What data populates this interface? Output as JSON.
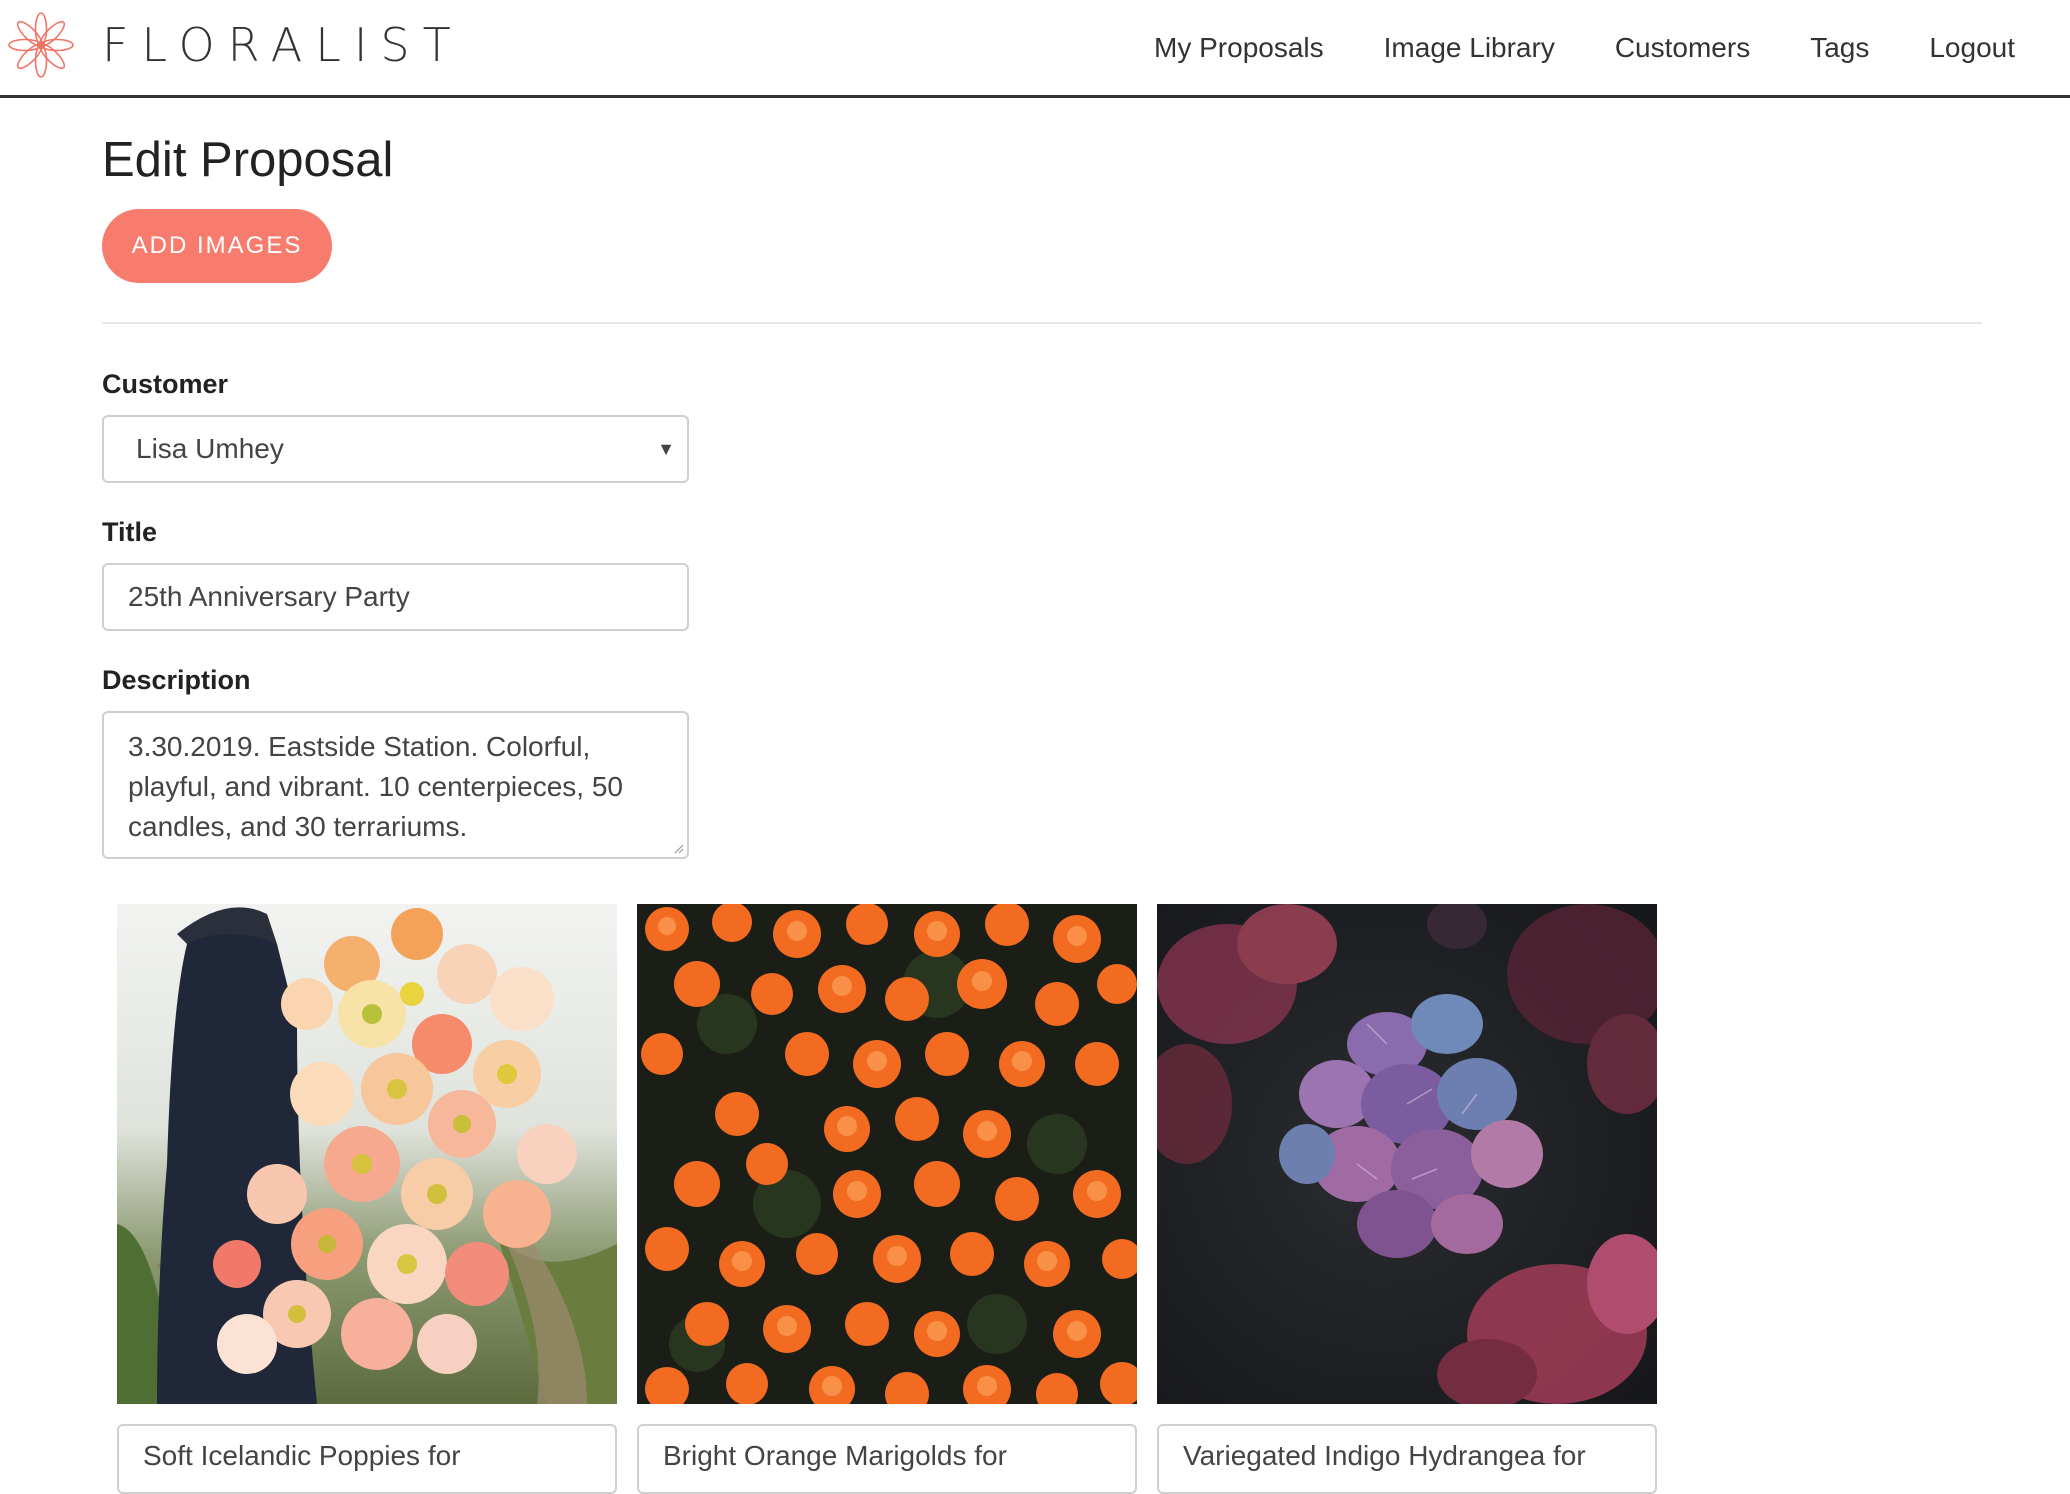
{
  "brand": {
    "name": "FLORALIST",
    "accent_color": "#f87c6d"
  },
  "nav": {
    "items": [
      {
        "label": "My Proposals"
      },
      {
        "label": "Image Library"
      },
      {
        "label": "Customers"
      },
      {
        "label": "Tags"
      },
      {
        "label": "Logout"
      }
    ]
  },
  "page": {
    "title": "Edit Proposal",
    "add_images_label": "ADD IMAGES"
  },
  "form": {
    "customer": {
      "label": "Customer",
      "value": "Lisa Umhey"
    },
    "title": {
      "label": "Title",
      "value": "25th Anniversary Party"
    },
    "description": {
      "label": "Description",
      "value": "3.30.2019. Eastside Station. Colorful, playful, and vibrant. 10 centerpieces, 50 candles, and 30 terrariums."
    }
  },
  "images": [
    {
      "caption": "Soft Icelandic Poppies for",
      "icon": "poppies-photo"
    },
    {
      "caption": "Bright Orange Marigolds for",
      "icon": "marigolds-photo"
    },
    {
      "caption": "Variegated Indigo Hydrangea for",
      "icon": "hydrangea-photo"
    }
  ]
}
